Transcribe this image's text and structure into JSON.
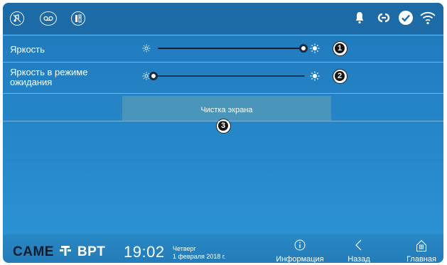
{
  "topbar": {
    "left_icons": [
      "music-off-icon",
      "voicemail-icon",
      "door-keys-icon"
    ],
    "status_icons": [
      "bell-icon",
      "link-icon",
      "check-circle-icon",
      "wifi-icon"
    ]
  },
  "settings": {
    "brightness": {
      "label": "Яркость",
      "level": 1.0,
      "badge": "1"
    },
    "standby_brightness": {
      "label_line1": "Яркость в режиме",
      "label_line2": "ожидания",
      "level": 0.0,
      "badge": "2"
    },
    "clean_screen": {
      "label": "Чистка экрана",
      "badge": "3"
    }
  },
  "footer": {
    "brand_left": "CAME",
    "brand_right": "BPT",
    "time": "19:02",
    "weekday": "Четверг",
    "date": "1 февраля 2018 г.",
    "nav": {
      "info": "Информация",
      "back": "Назад",
      "home": "Главная"
    }
  },
  "colors": {
    "background": "#2585c7",
    "topbar": "#1c6aa6",
    "text": "#ffffff"
  }
}
